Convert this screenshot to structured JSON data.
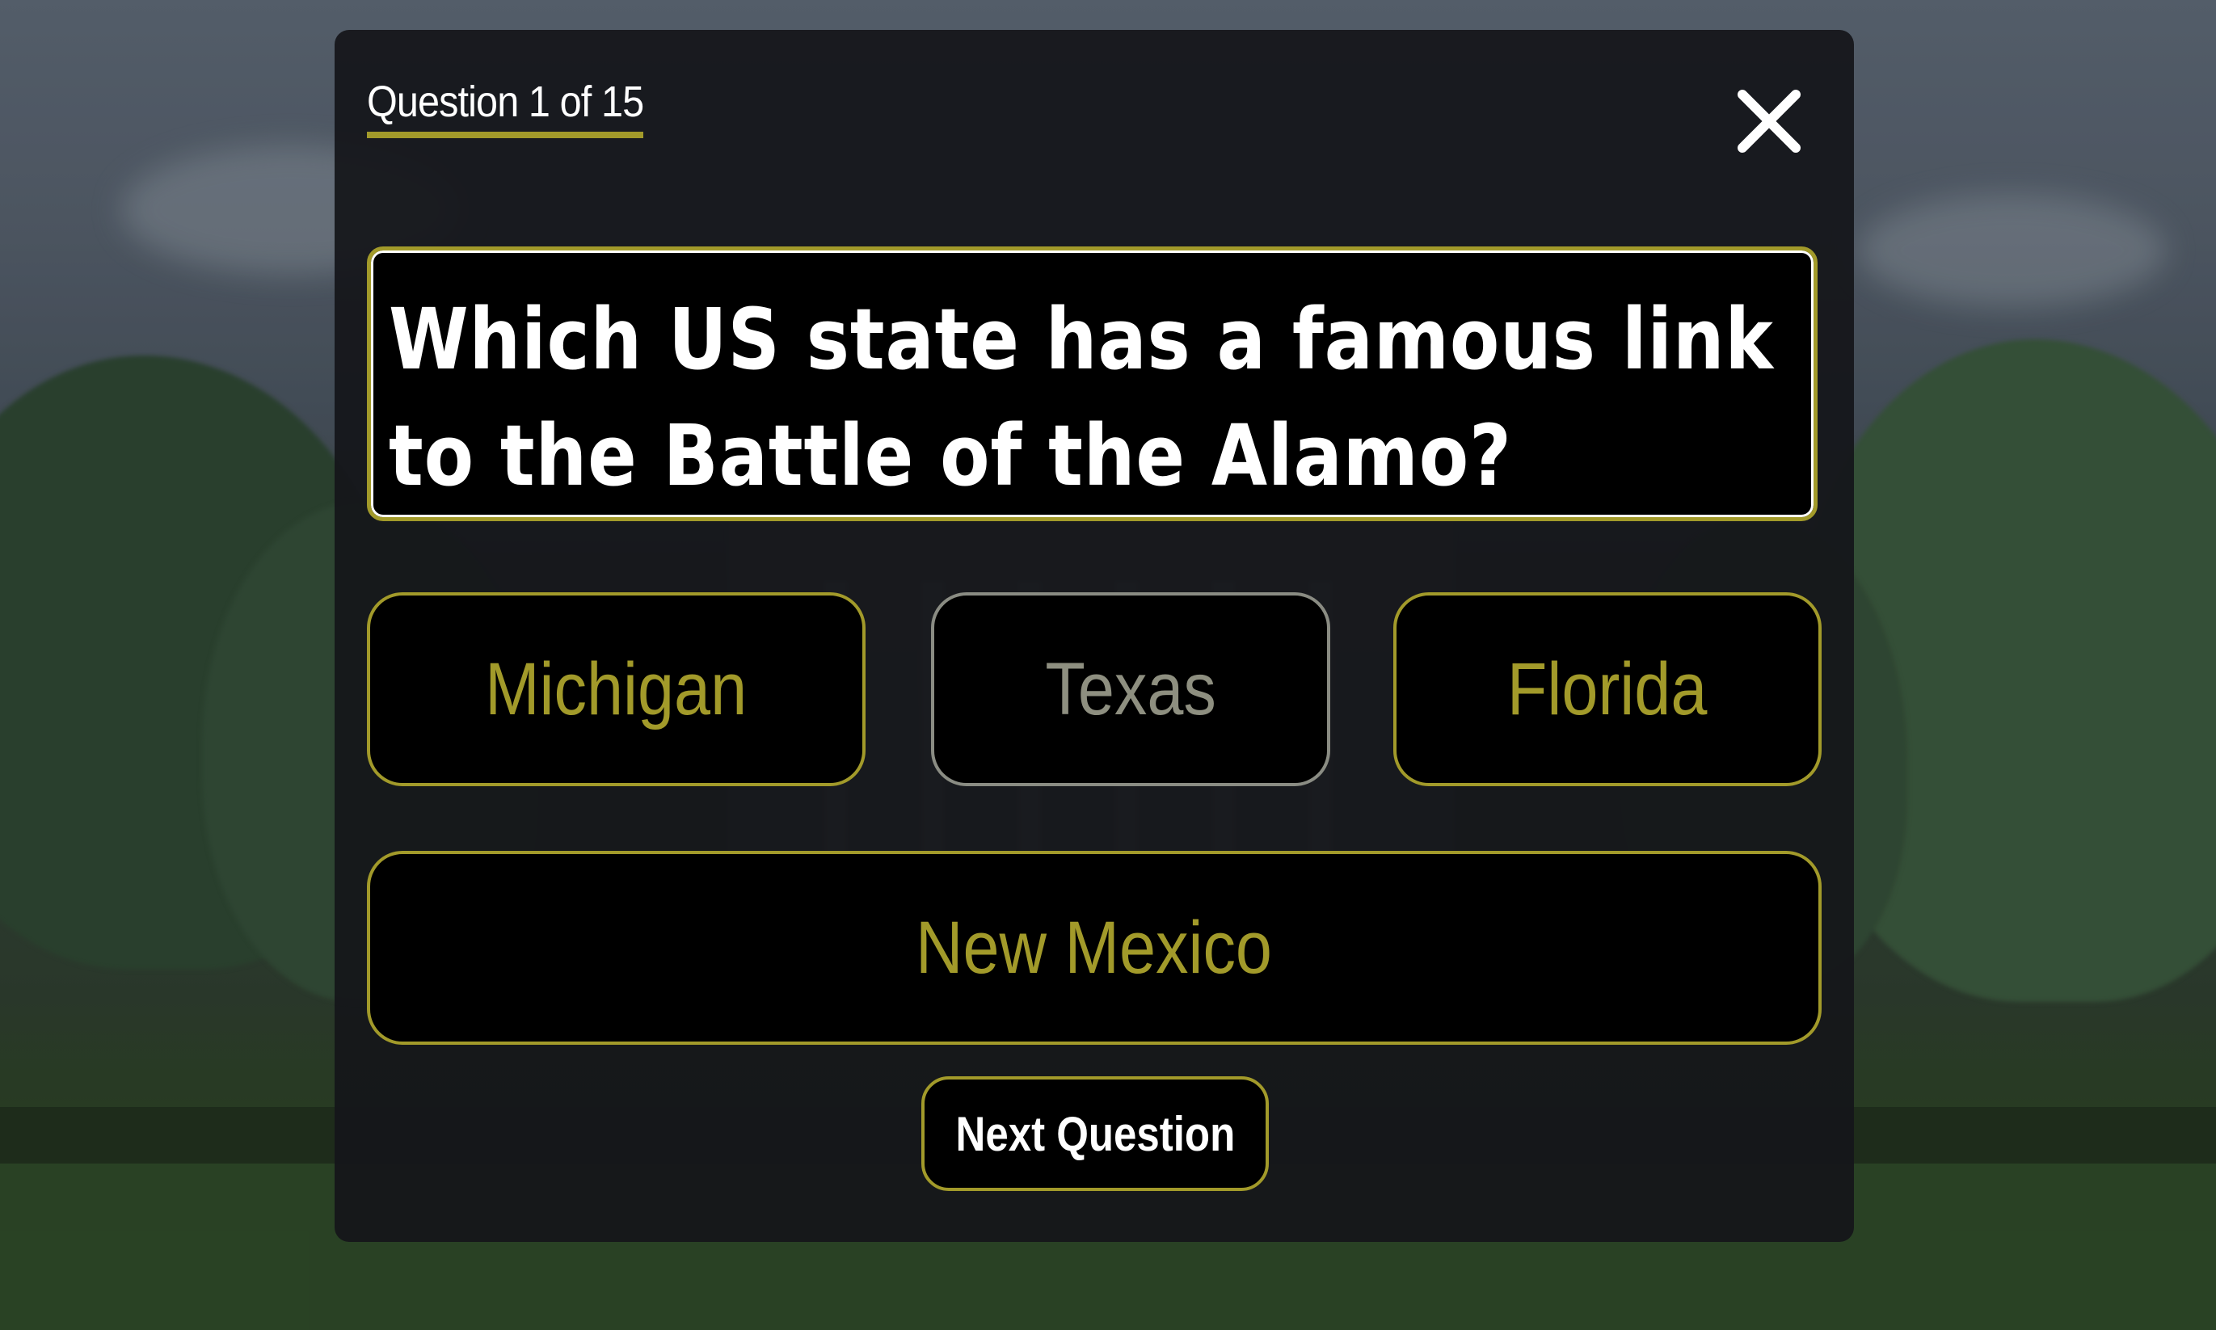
{
  "quiz": {
    "counter_label": "Question 1 of 15",
    "question": "Which US state has a famous link to the Battle of the Alamo?",
    "answers": [
      {
        "label": "Michigan"
      },
      {
        "label": "Texas"
      },
      {
        "label": "Florida"
      },
      {
        "label": "New Mexico"
      }
    ],
    "next_label": "Next Question"
  },
  "icons": {
    "close": "close-icon"
  },
  "colors": {
    "accent": "#a29a2a",
    "muted_answer": "#8e8f80",
    "panel": "#14161a",
    "text": "#ffffff"
  }
}
